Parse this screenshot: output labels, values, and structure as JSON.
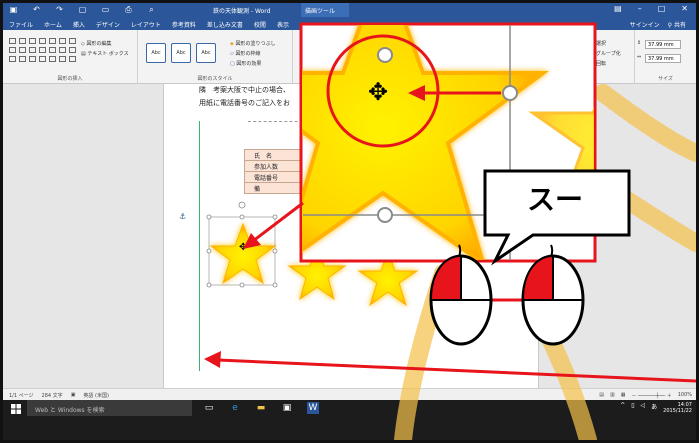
{
  "titlebar": {
    "title": "鉄の天体観測 - Word",
    "context_tab": "描画ツール",
    "qat": [
      "保存",
      "元に戻す",
      "やり直し",
      "新規",
      "開く",
      "印刷",
      "プレビュー"
    ],
    "win_controls": [
      "リボン表示",
      "最小化",
      "最大化",
      "閉じる"
    ]
  },
  "tabs": [
    "ファイル",
    "ホーム",
    "挿入",
    "デザイン",
    "レイアウト",
    "参考資料",
    "差し込み文書",
    "校閲",
    "表示"
  ],
  "signin": {
    "label": "サインイン",
    "share": "共有"
  },
  "ribbon": {
    "insert_shapes": {
      "edit_shape": "図形の編集",
      "textbox": "テキスト ボックス",
      "group_label": "図形の挿入"
    },
    "shape_styles": {
      "style_samples": [
        "Abc",
        "Abc",
        "Abc"
      ],
      "fill": "図形の塗りつぶし",
      "outline": "図形の枠線",
      "effects": "図形の効果",
      "group_label": "図形のスタイル"
    },
    "arrange": {
      "select": "選択",
      "group": "グループ化",
      "rotate": "回転"
    },
    "size": {
      "height": "37.99 mm",
      "width": "37.99 mm",
      "group_label": "サイズ"
    }
  },
  "document": {
    "line1": "隣　考案大阪で中止の場合、",
    "line2": "用紙に電話番号のご記入をお",
    "table_rows": [
      "氏　名",
      "参加人数",
      "電話番号",
      "備"
    ]
  },
  "callout": {
    "text": "スー"
  },
  "statusbar": {
    "page": "1/1 ページ",
    "words": "284 文字",
    "language": "英語 (米国)",
    "zoom": "100%"
  },
  "taskbar": {
    "search": "Web と Windows を検索",
    "time": "14:07",
    "date": "2015/11/22"
  },
  "colors": {
    "word_blue": "#2b579a",
    "annotation_red": "#e8141b",
    "star_yellow": "#ffe600",
    "star_glow": "#ffb300",
    "cursor_trail": "#f5c04a"
  }
}
